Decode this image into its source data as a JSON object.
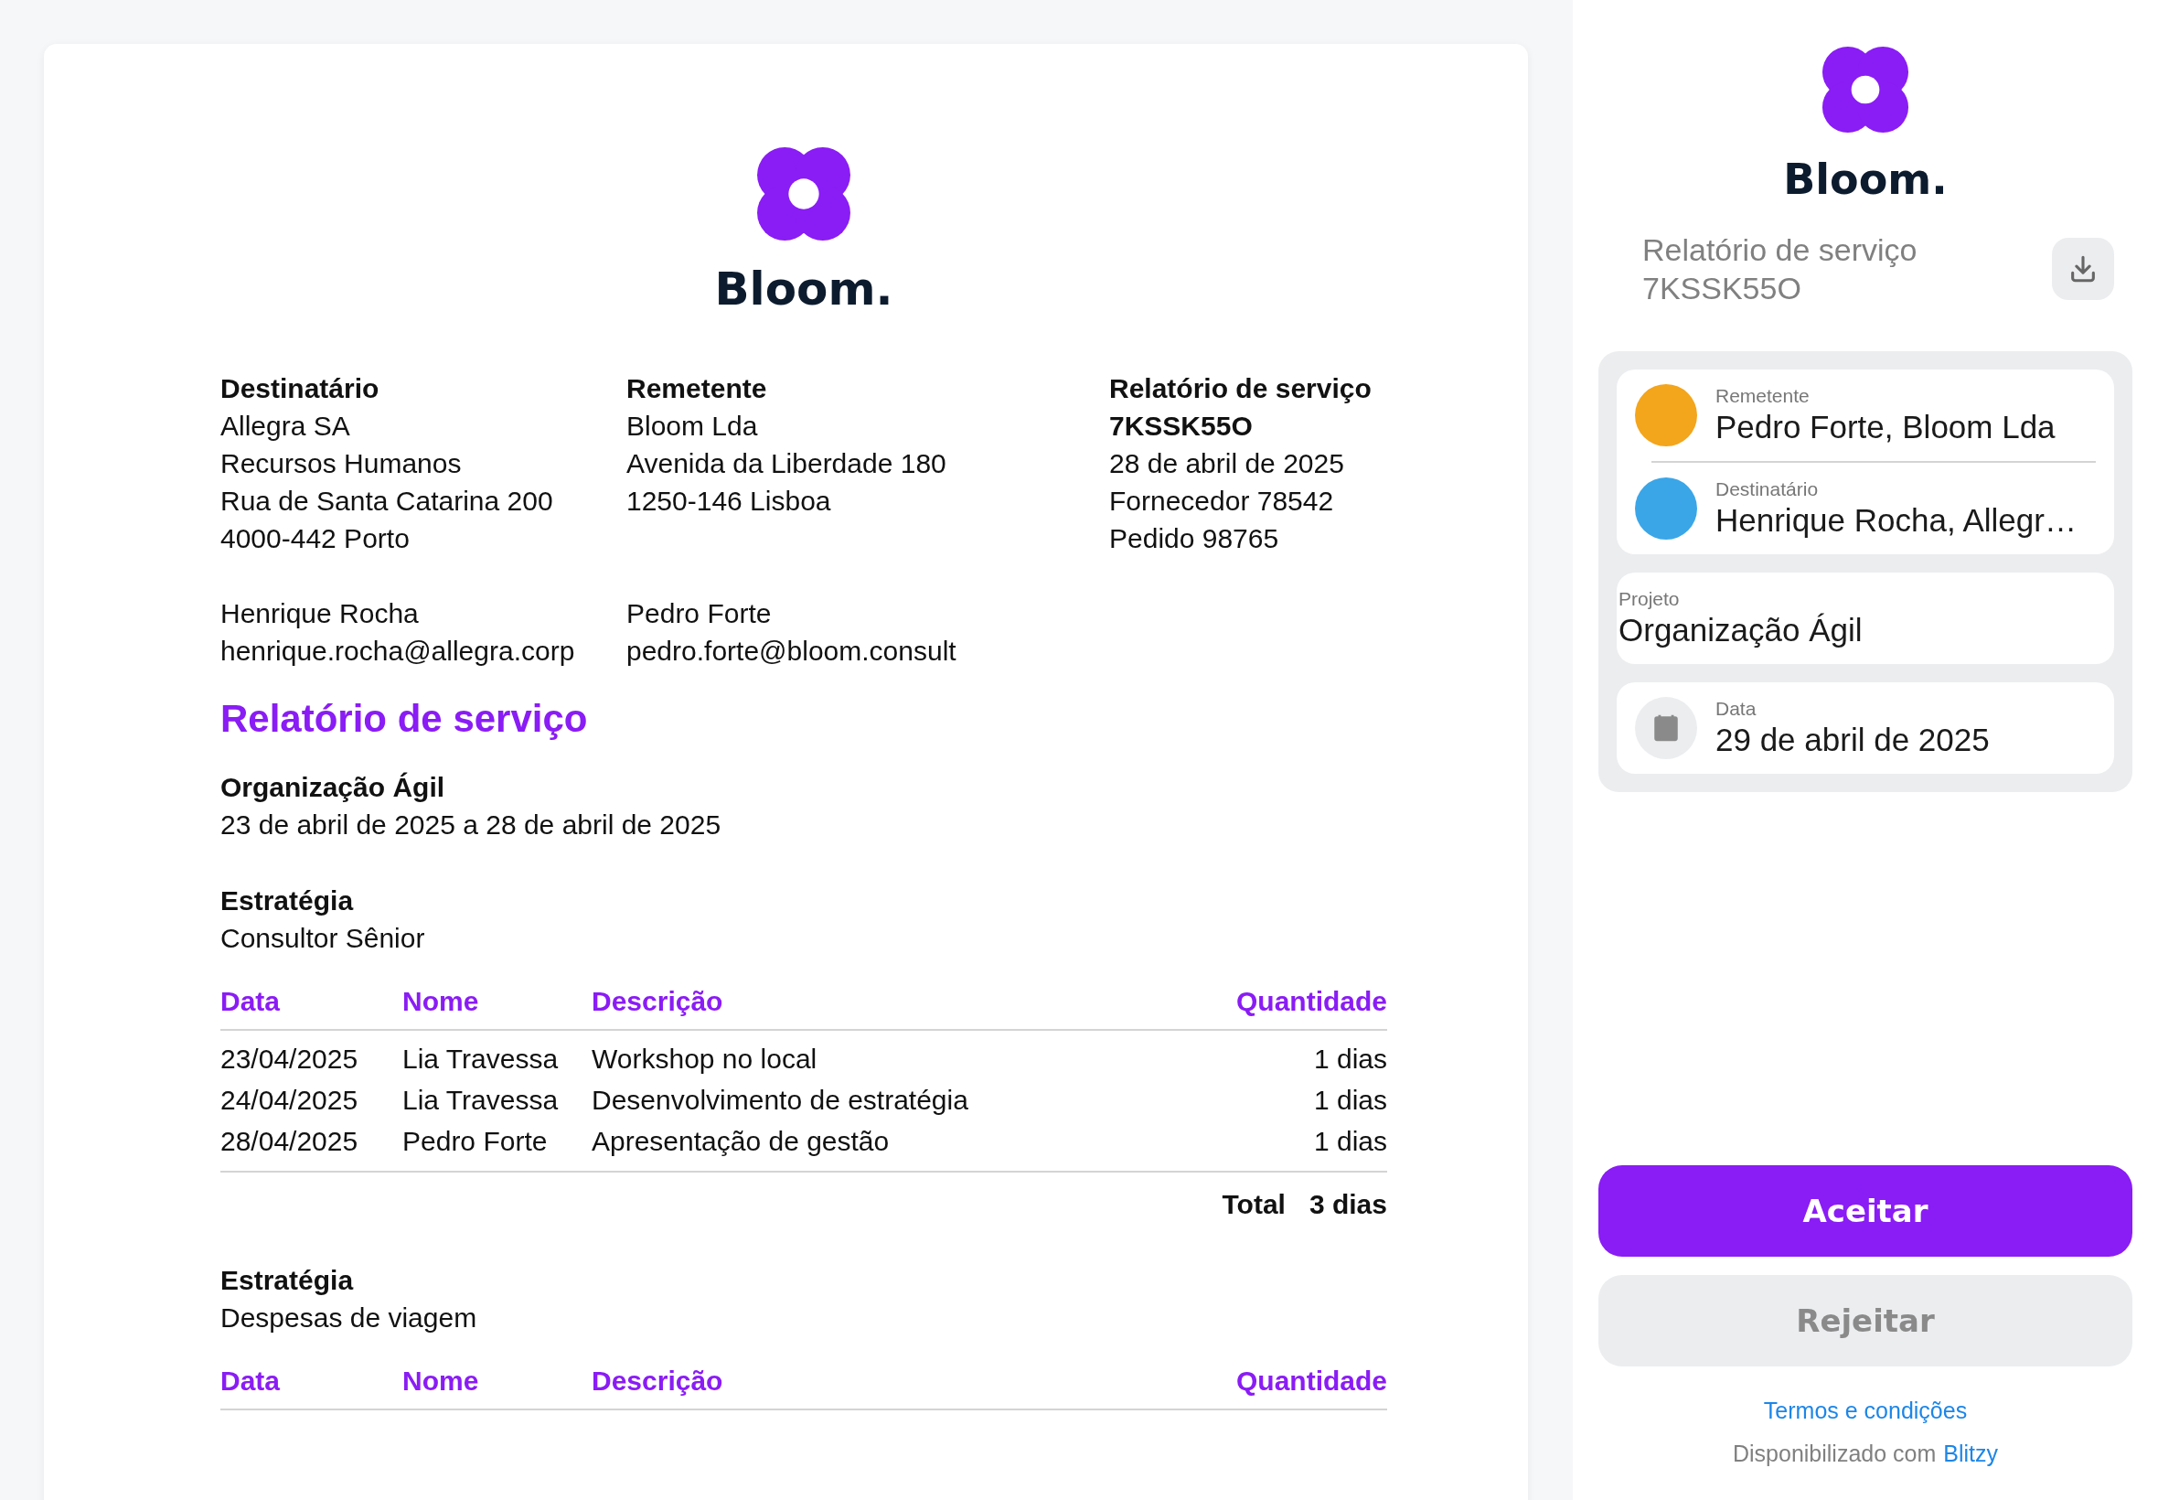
{
  "document": {
    "logo_text": "Bloom.",
    "address_blocks": [
      {
        "heading_lines": [
          "Destinatário"
        ],
        "lines": [
          "Allegra SA",
          "Recursos Humanos",
          "Rua de Santa Catarina 200",
          "4000-442 Porto"
        ]
      },
      {
        "heading_lines": [
          "Remetente"
        ],
        "lines": [
          "Bloom Lda",
          "Avenida da Liberdade 180",
          "1250-146 Lisboa"
        ]
      },
      {
        "heading_lines": [
          "Relatório de serviço",
          "7KSSK55O"
        ],
        "lines": [
          "28 de abril de 2025",
          "Fornecedor 78542",
          "Pedido 98765"
        ]
      }
    ],
    "contacts": [
      {
        "name": "Henrique Rocha",
        "email": "henrique.rocha@allegra.corp"
      },
      {
        "name": "Pedro Forte",
        "email": "pedro.forte@bloom.consult"
      }
    ],
    "title": "Relatório de serviço",
    "project": {
      "name": "Organização Ágil",
      "period": "23 de abril de 2025 a 28 de abril de 2025"
    },
    "sections": [
      {
        "category": "Estratégia",
        "role": "Consultor Sênior",
        "columns": [
          "Data",
          "Nome",
          "Descrição",
          "Quantidade"
        ],
        "rows": [
          [
            "23/04/2025",
            "Lia Travessa",
            "Workshop no local",
            "1 dias"
          ],
          [
            "24/04/2025",
            "Lia Travessa",
            "Desenvolvimento de estratégia",
            "1 dias"
          ],
          [
            "28/04/2025",
            "Pedro Forte",
            "Apresentação de gestão",
            "1 dias"
          ]
        ],
        "total_label": "Total",
        "total_value": "3 dias"
      },
      {
        "category": "Estratégia",
        "role": "Despesas de viagem",
        "columns": [
          "Data",
          "Nome",
          "Descrição",
          "Quantidade"
        ]
      }
    ]
  },
  "sidebar": {
    "logo_text": "Bloom.",
    "title": "Relatório de serviço",
    "code": "7KSSK55O",
    "parties": [
      {
        "label": "Remetente",
        "value": "Pedro Forte, Bloom Lda"
      },
      {
        "label": "Destinatário",
        "value": "Henrique Rocha, Allegr…"
      }
    ],
    "project": {
      "label": "Projeto",
      "value": "Organização Ágil"
    },
    "date": {
      "label": "Data",
      "value": "29 de abril de 2025"
    },
    "buttons": [
      {
        "label": "Aceitar",
        "kind": "primary"
      },
      {
        "label": "Rejeitar",
        "kind": "secondary"
      }
    ],
    "terms_link": "Termos e condições",
    "footer": {
      "text": "Disponibilizado com",
      "link": "Blitzy"
    }
  }
}
